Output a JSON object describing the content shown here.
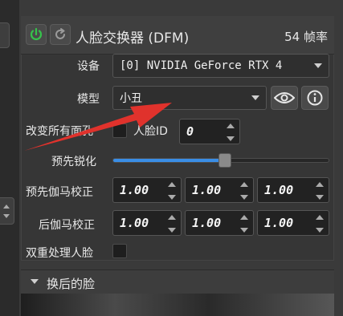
{
  "header": {
    "title": "人脸交换器 (DFM)",
    "fps": "54 帧率"
  },
  "device": {
    "label": "设备",
    "value": "[0] NVIDIA GeForce RTX 4"
  },
  "model": {
    "label": "模型",
    "value": "小丑"
  },
  "morph": {
    "label": "改变所有面孔",
    "face_id_label": "人脸ID",
    "face_id_value": "0"
  },
  "sharpen": {
    "label": "预先锐化",
    "level": 0.52
  },
  "pre_gamma": {
    "label": "预先伽马校正",
    "values": [
      "1.00",
      "1.00",
      "1.00"
    ]
  },
  "post_gamma": {
    "label": "后伽马校正",
    "values": [
      "1.00",
      "1.00",
      "1.00"
    ]
  },
  "double_pass": {
    "label": "双重处理人脸"
  },
  "next_section": {
    "title": "换后的脸"
  },
  "colors": {
    "accent": "#3a8ee6",
    "power_green": "#36c24b",
    "arrow_red": "#e0322c"
  }
}
